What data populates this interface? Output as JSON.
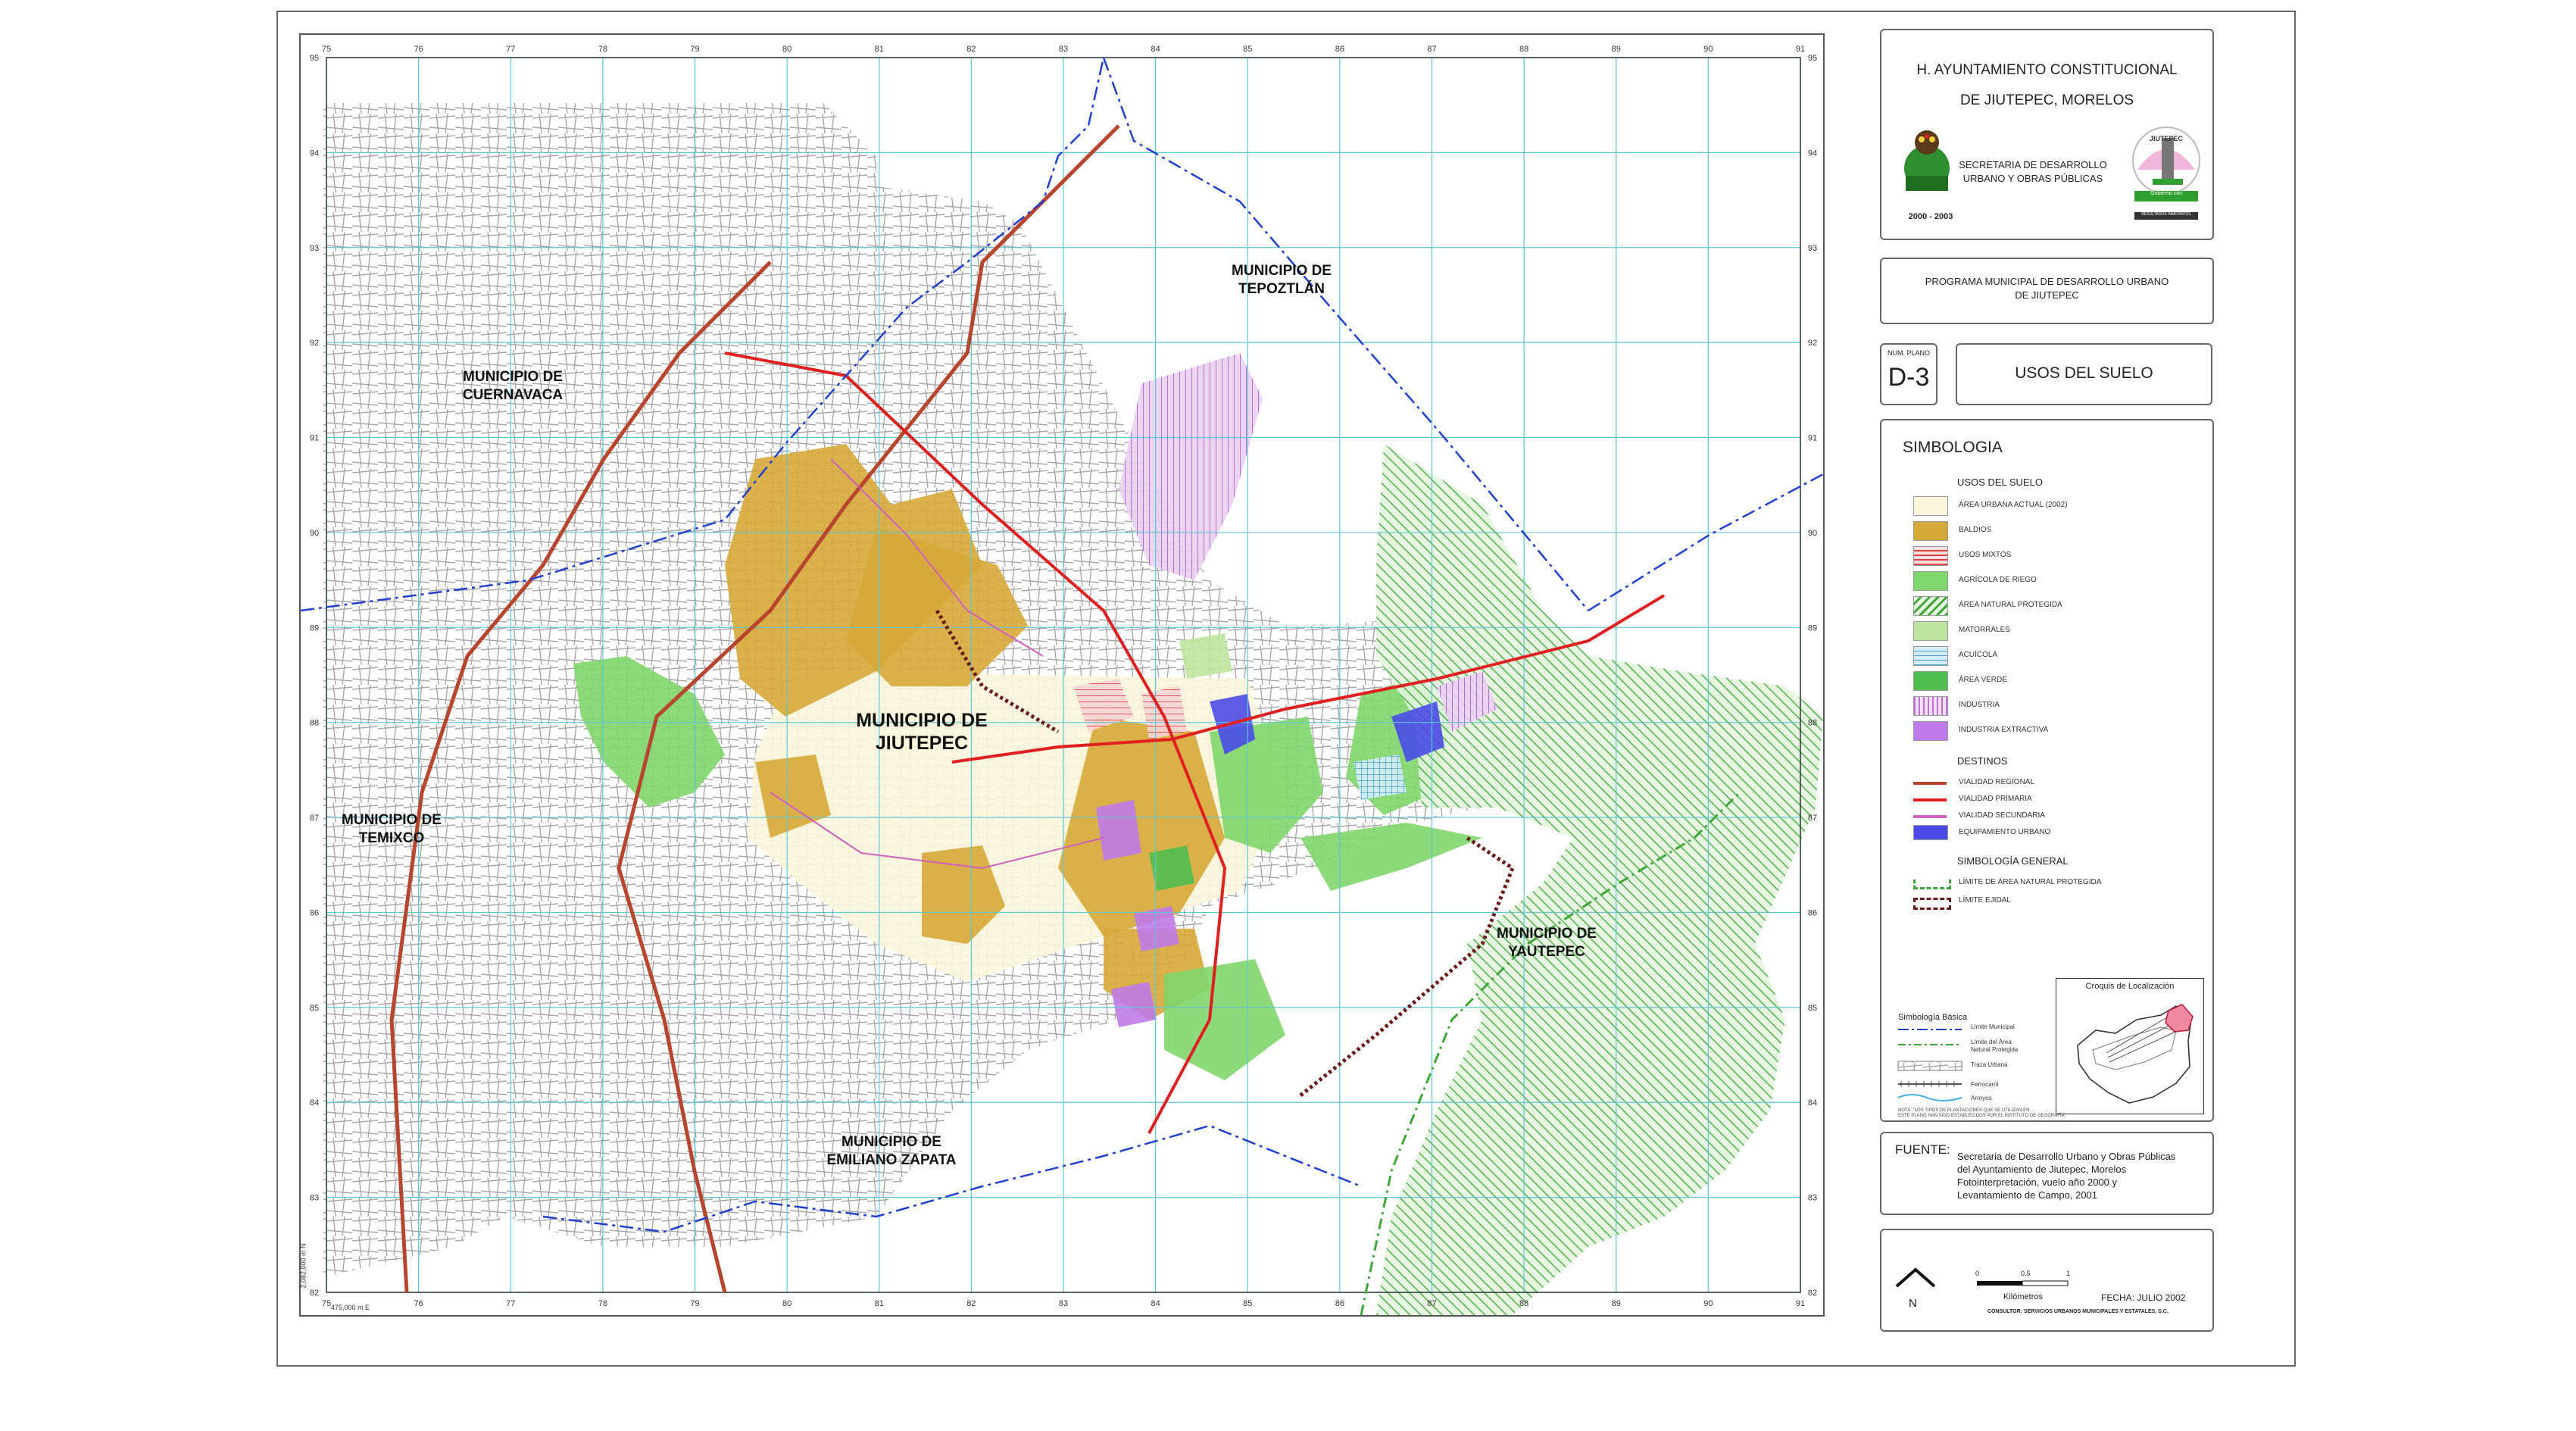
{
  "colors": {
    "urbana": "#fbf6dc",
    "baldios": "#d6a838",
    "usos_mixtos": "#e87b7b",
    "agricola": "#7fd66a",
    "natural_protegida": "#3fa73a",
    "matorrales": "#bfe6a0",
    "acuicola": "#3ca3d8",
    "area_verde": "#4fbf4f",
    "industria": "#e7b5ee",
    "industria_extractiva": "#c07be8",
    "vialidad_regional": "#b8452d",
    "vialidad_primaria": "#e02020",
    "vialidad_secundaria": "#d060c0",
    "equipamiento": "#4a4ae8",
    "limite_ejidal": "#6b1a1a",
    "limite_municipal": "#2040d0",
    "grid": "#5fc6d6",
    "street": "#9a9a9a"
  },
  "grid": {
    "x_labels": [
      "75",
      "76",
      "77",
      "78",
      "79",
      "80",
      "81",
      "82",
      "83",
      "84",
      "85",
      "86",
      "87",
      "88",
      "89",
      "90",
      "91"
    ],
    "y_labels": [
      "95",
      "94",
      "93",
      "92",
      "91",
      "90",
      "89",
      "88",
      "87",
      "86",
      "85",
      "84",
      "83",
      "82"
    ]
  },
  "map": {
    "labels": {
      "tepoztlan": "MUNICIPIO DE\nTEPOZTLÁN",
      "cuernavaca": "MUNICIPIO DE\nCUERNAVACA",
      "jiutepec": "MUNICIPIO DE\nJIUTEPEC",
      "temixco": "MUNICIPIO DE\nTEMIXCO",
      "yautepec": "MUNICIPIO DE\nYAUTEPEC",
      "emiliano": "MUNICIPIO DE\nEMILIANO ZAPATA"
    },
    "corner_label": "475,000 m E",
    "side_label": "2,082,000 m N"
  },
  "title_panel": {
    "line1": "H. AYUNTAMIENTO CONSTITUCIONAL",
    "line2": "DE JIUTEPEC, MORELOS",
    "dept1": "SECRETARIA DE DESARROLLO",
    "dept2": "URBANO Y OBRAS PÚBLICAS",
    "period": "2000 - 2003",
    "logo_right_text": "JIUTEPEC",
    "logo_right_sub": "Gobierno con",
    "logo_right_sub2": "RESULTADOS INMEDIATOS"
  },
  "program_panel": {
    "line1": "PROGRAMA MUNICIPAL DE DESARROLLO URBANO",
    "line2": "DE JIUTEPEC"
  },
  "plano": {
    "label": "NUM. PLANO",
    "number": "D-3",
    "title": "USOS DEL SUELO"
  },
  "symbology": {
    "heading": "SIMBOLOGIA",
    "usos_heading": "USOS DEL SUELO",
    "usos": [
      {
        "label": "ÁREA URBANA ACTUAL (2002)",
        "key": "urbana"
      },
      {
        "label": "BALDIOS",
        "key": "baldios"
      },
      {
        "label": "USOS MIXTOS",
        "key": "usos_mixtos"
      },
      {
        "label": "AGRÍCOLA DE RIEGO",
        "key": "agricola"
      },
      {
        "label": "ÁREA NATURAL PROTEGIDA",
        "key": "natural_protegida"
      },
      {
        "label": "MATORRALES",
        "key": "matorrales"
      },
      {
        "label": "ACUÍCOLA",
        "key": "acuicola"
      },
      {
        "label": "ÁREA VERDE",
        "key": "area_verde"
      },
      {
        "label": "INDUSTRIA",
        "key": "industria"
      },
      {
        "label": "INDUSTRIA EXTRACTIVA",
        "key": "industria_extractiva"
      }
    ],
    "destinos_heading": "DESTINOS",
    "destinos": [
      {
        "label": "VIALIDAD REGIONAL",
        "key": "vialidad_regional"
      },
      {
        "label": "VIALIDAD PRIMARIA",
        "key": "vialidad_primaria"
      },
      {
        "label": "VIALIDAD SECUNDARIA",
        "key": "vialidad_secundaria"
      },
      {
        "label": "EQUIPAMIENTO URBANO",
        "key": "equipamiento"
      }
    ],
    "general_heading": "SIMBOLOGÍA GENERAL",
    "general": [
      {
        "label": "LÍMITE DE ÁREA NATURAL PROTEGIDA",
        "key": "natural_protegida"
      },
      {
        "label": "LÍMITE EJIDAL",
        "key": "limite_ejidal"
      }
    ],
    "basica_heading": "Simbología Básica",
    "basica": [
      "Límite Municipal",
      "Límite del Área\nNatural Protegida",
      "Traza Urbana",
      "Ferrocarril",
      "Arroyos"
    ],
    "croquis_heading": "Croquis de Localización",
    "note": "NOTA: \"LOS TIPOS DE PLANTACIONES QUE SE UTILIZAN EN\nESTE PLANO HAN SIDO ESTABLECIDOS POR EL INSTITUTO DE GEOGRAFÍA\""
  },
  "fuente": {
    "label": "FUENTE:",
    "lines": [
      "Secretaria de Desarrollo Urbano y Obras Públicas",
      "del Ayuntamiento de Jiutepec, Morelos",
      "Fotointerpretación, vuelo año 2000 y",
      "Levantamiento de Campo, 2001"
    ]
  },
  "scale_panel": {
    "north": "N",
    "scale_ticks": [
      "0",
      "0.5",
      "1"
    ],
    "units": "Kilómetros",
    "fecha": "FECHA: JULIO 2002",
    "consultor": "CONSULTOR: SERVICIOS URBANOS MUNICIPALES Y ESTATALES, S.C."
  }
}
